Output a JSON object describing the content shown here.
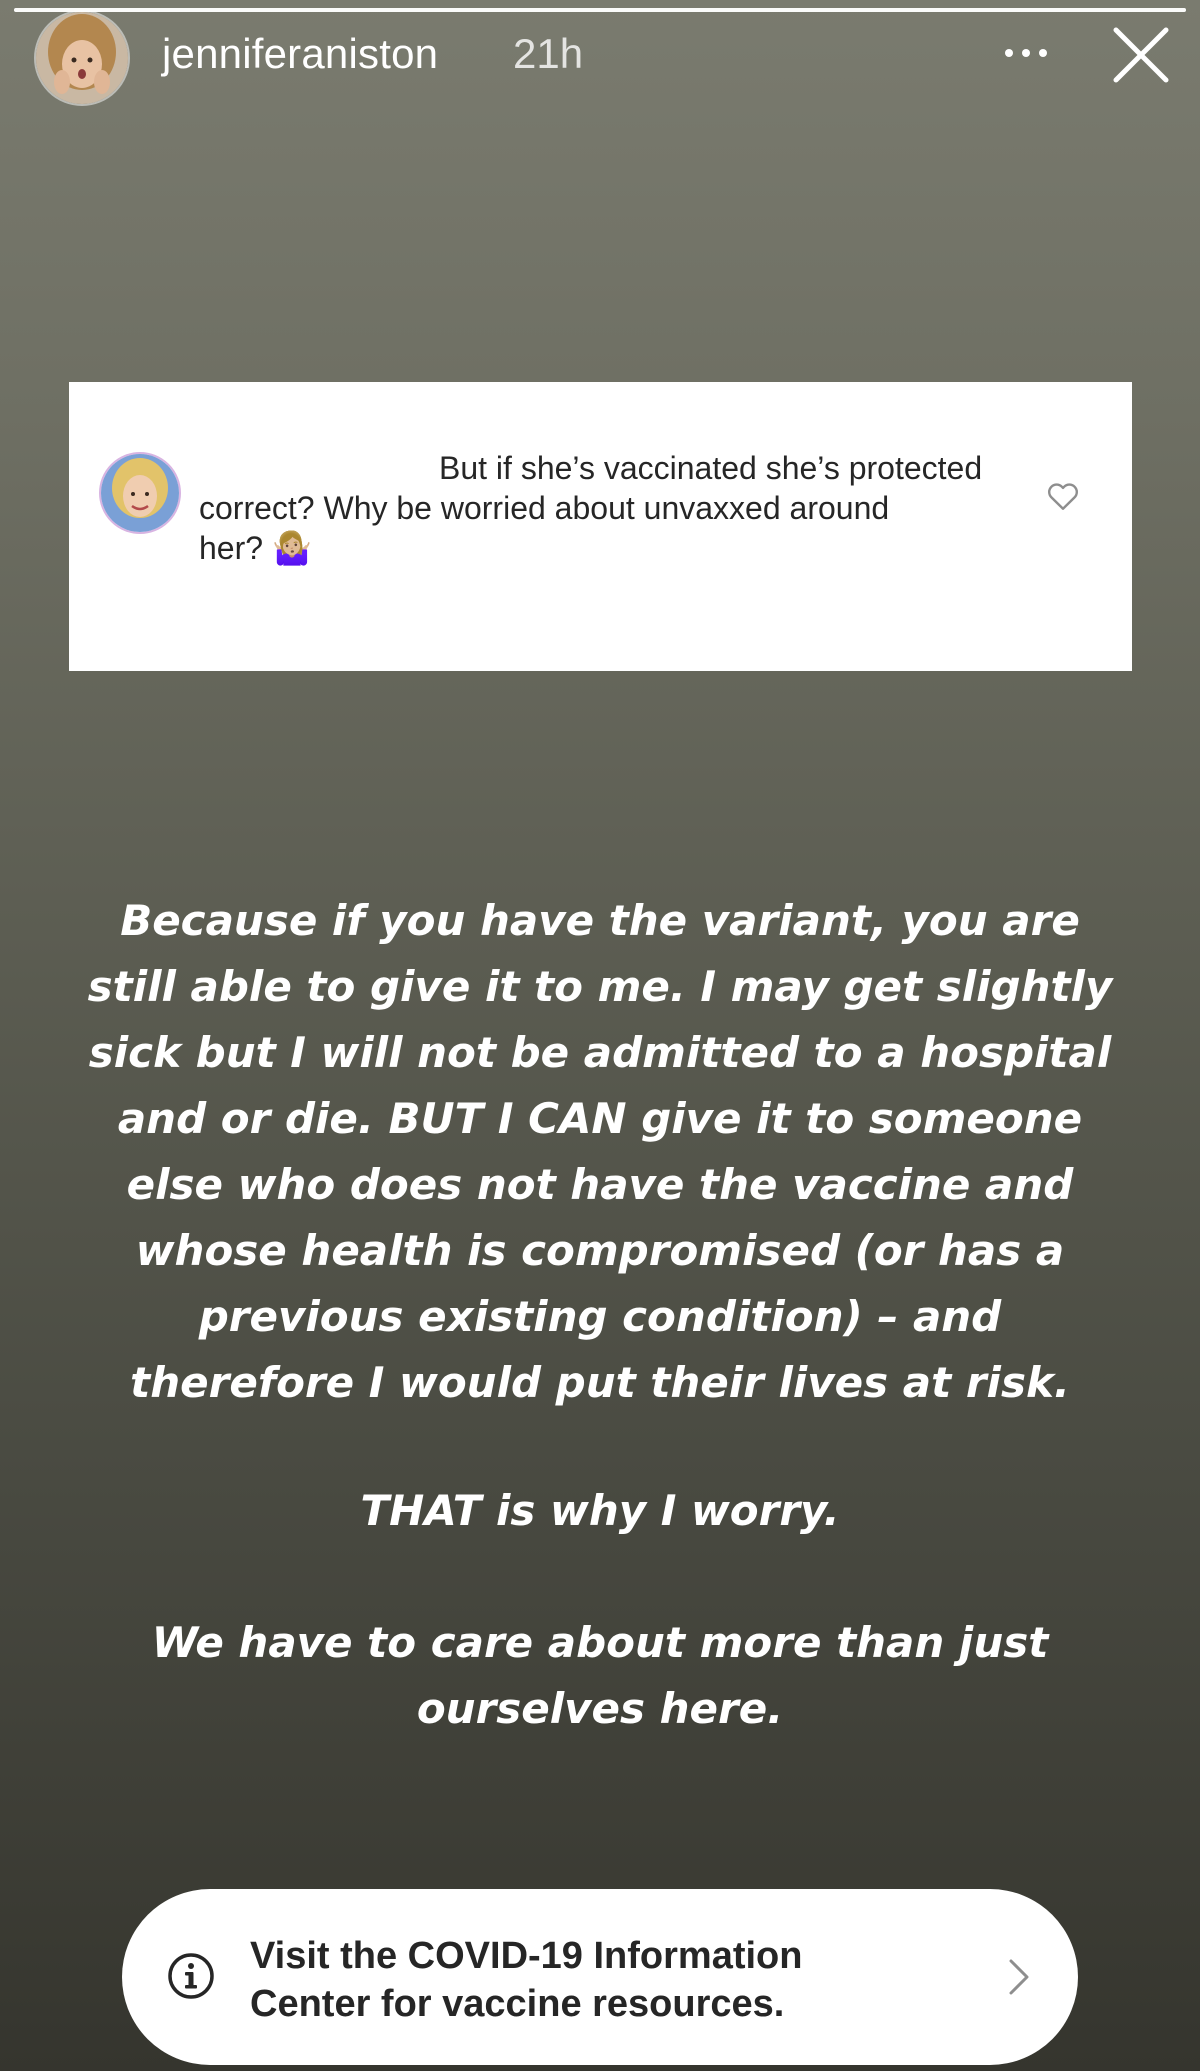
{
  "story": {
    "username": "jenniferaniston",
    "time_ago": "21h",
    "progress": 1.0
  },
  "header": {
    "more_icon": "more-horizontal-icon",
    "close_icon": "close-icon"
  },
  "question_card": {
    "lines": [
      "But if she’s vaccinated she’s protected",
      "correct? Why be worried about unvaxxed around",
      "her? 🤷🏼‍♀️"
    ],
    "like_icon": "heart-icon"
  },
  "message": {
    "main_lines": [
      "Because if you have the variant, you are",
      "still able to give it to me. I may get slightly",
      "sick but I will not be admitted to a hospital",
      "and or die. BUT I CAN give it to someone",
      "else who does not have the vaccine and",
      "whose health is compromised (or has a",
      "previous existing condition) – and",
      "therefore I would put their lives at risk."
    ],
    "worry_line": "THAT is why I worry.",
    "care_lines": [
      "We have to care about more than just",
      "ourselves here."
    ]
  },
  "covid_sticker": {
    "lines": [
      "Visit the COVID-19 Information",
      "Center for vaccine resources."
    ],
    "info_icon": "info-icon",
    "chevron_icon": "chevron-right-icon"
  },
  "colors": {
    "background_top": "#7a7b6f",
    "background_bottom": "#35352e",
    "card": "#ffffff",
    "text_dark": "#262626"
  }
}
